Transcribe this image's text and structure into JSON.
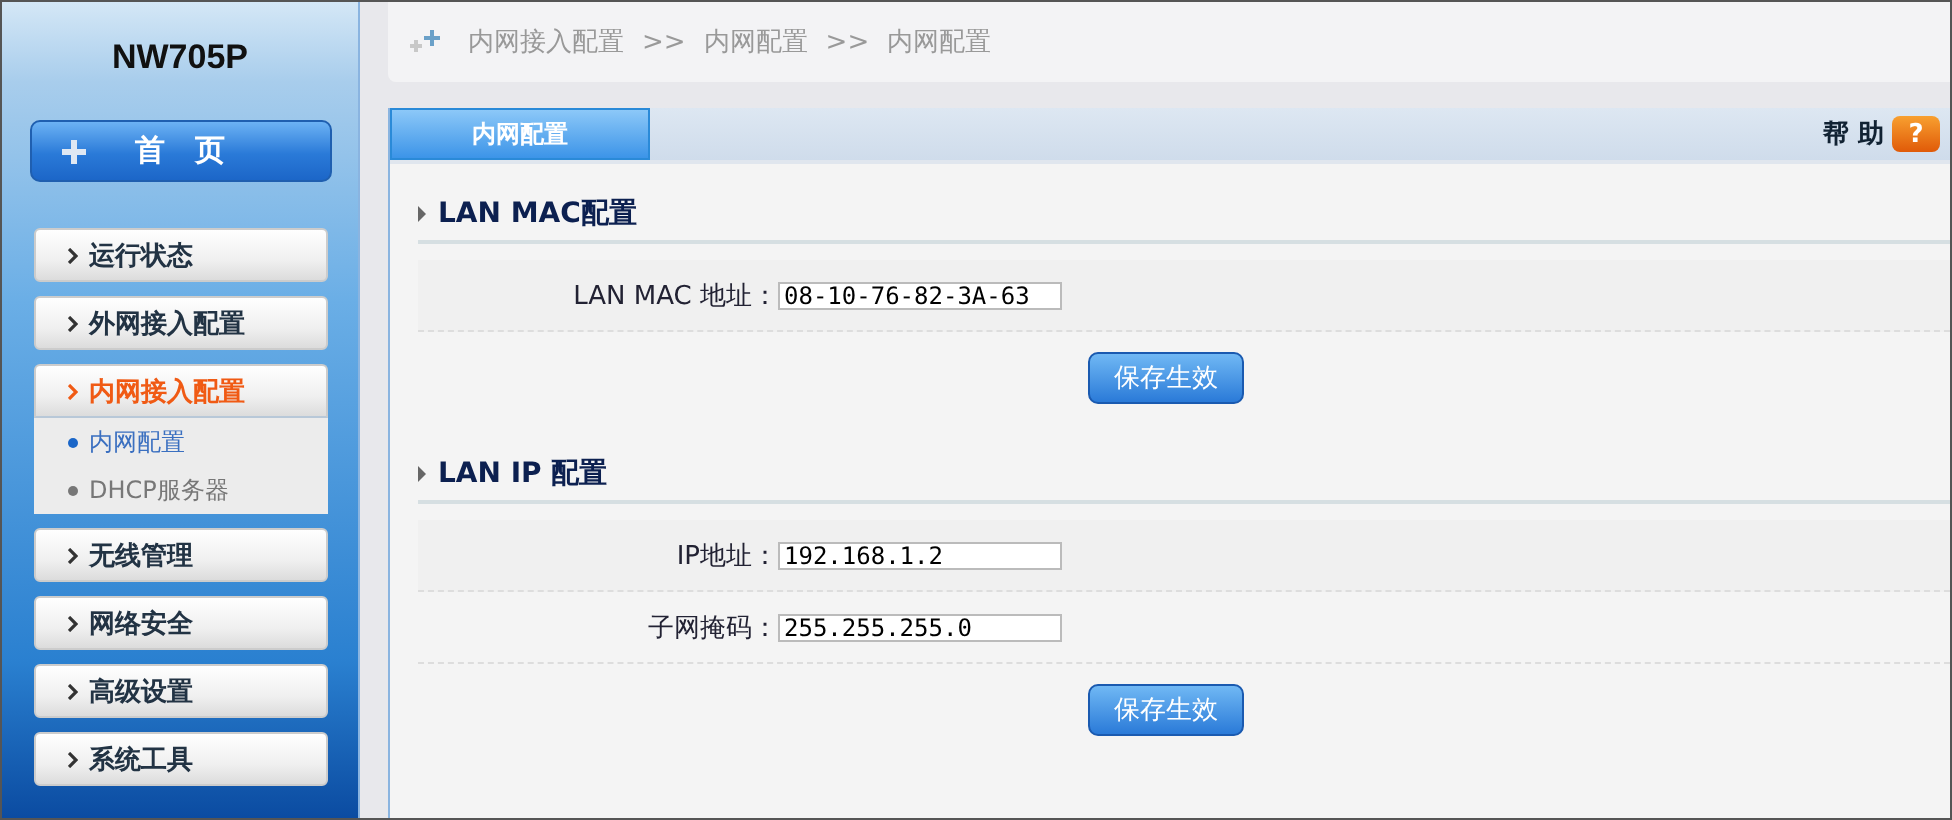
{
  "sidebar": {
    "title": "NW705P",
    "home_button": {
      "label": "首　页"
    },
    "menu": [
      {
        "label": "运行状态",
        "selected": false,
        "expanded": false
      },
      {
        "label": "外网接入配置",
        "selected": false,
        "expanded": false
      },
      {
        "label": "内网接入配置",
        "selected": true,
        "expanded": true,
        "children": [
          {
            "label": "内网配置",
            "selected": true
          },
          {
            "label": "DHCP服务器",
            "selected": false
          }
        ]
      },
      {
        "label": "无线管理",
        "selected": false,
        "expanded": false
      },
      {
        "label": "网络安全",
        "selected": false,
        "expanded": false
      },
      {
        "label": "高级设置",
        "selected": false,
        "expanded": false
      },
      {
        "label": "系统工具",
        "selected": false,
        "expanded": false
      }
    ]
  },
  "breadcrumb": {
    "items": [
      "内网接入配置",
      "内网配置",
      "内网配置"
    ],
    "separator": ">>"
  },
  "tabs": [
    {
      "label": "内网配置",
      "selected": true
    }
  ],
  "help": {
    "label": "帮 助",
    "icon_text": "?"
  },
  "sections": [
    {
      "title": "LAN MAC配置",
      "fields": [
        {
          "label": "LAN MAC 地址：",
          "value": "08-10-76-82-3A-63"
        }
      ],
      "button": "保存生效"
    },
    {
      "title": "LAN IP 配置",
      "fields": [
        {
          "label": "IP地址：",
          "value": "192.168.1.2"
        },
        {
          "label": "子网掩码：",
          "value": "255.255.255.0"
        }
      ],
      "button": "保存生效"
    }
  ]
}
